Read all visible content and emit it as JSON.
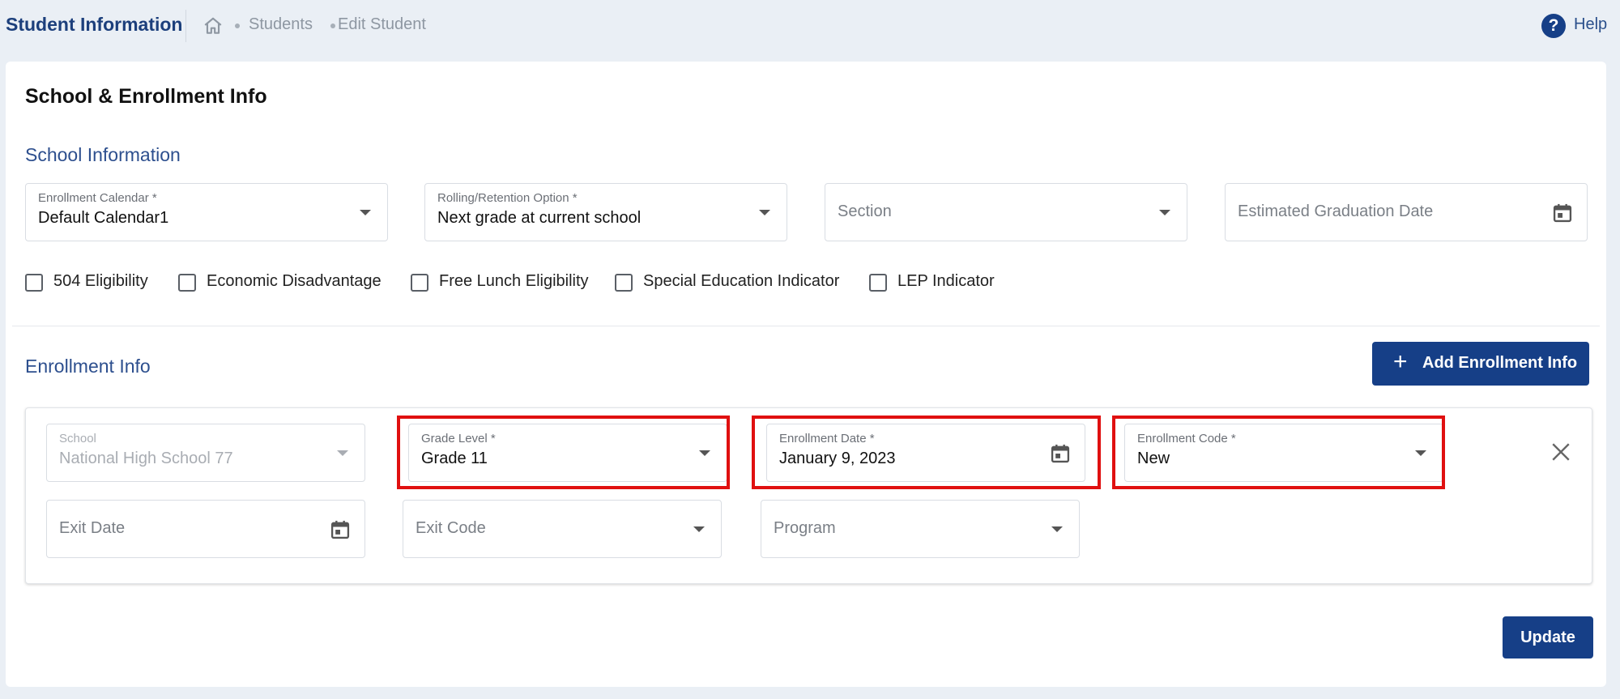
{
  "header": {
    "app_title": "Student Information",
    "breadcrumbs": [
      "Students",
      "Edit Student"
    ],
    "help_label": "Help"
  },
  "card": {
    "title": "School & Enrollment Info"
  },
  "school_information": {
    "section_title": "School Information",
    "enrollment_calendar": {
      "label": "Enrollment Calendar *",
      "value": "Default Calendar1"
    },
    "rolling_retention": {
      "label": "Rolling/Retention Option *",
      "value": "Next grade at current school"
    },
    "section": {
      "placeholder": "Section"
    },
    "estimated_graduation_date": {
      "placeholder": "Estimated Graduation Date"
    },
    "checkboxes": [
      {
        "label": "504 Eligibility",
        "checked": false
      },
      {
        "label": "Economic Disadvantage",
        "checked": false
      },
      {
        "label": "Free Lunch Eligibility",
        "checked": false
      },
      {
        "label": "Special Education Indicator",
        "checked": false
      },
      {
        "label": "LEP Indicator",
        "checked": false
      }
    ]
  },
  "enrollment_info": {
    "section_title": "Enrollment Info",
    "add_button_label": "Add Enrollment Info",
    "school": {
      "label": "School",
      "value": "National High School 77",
      "disabled": true
    },
    "grade_level": {
      "label": "Grade Level *",
      "value": "Grade 11"
    },
    "enrollment_date": {
      "label": "Enrollment Date *",
      "value": "January 9, 2023"
    },
    "enrollment_code": {
      "label": "Enrollment Code *",
      "value": "New"
    },
    "exit_date": {
      "placeholder": "Exit Date"
    },
    "exit_code": {
      "placeholder": "Exit Code"
    },
    "program": {
      "placeholder": "Program"
    }
  },
  "actions": {
    "update_label": "Update"
  },
  "colors": {
    "primary": "#163f87",
    "section_title": "#2d4f8e",
    "highlight": "#e01010",
    "page_background": "#eaeff5"
  }
}
